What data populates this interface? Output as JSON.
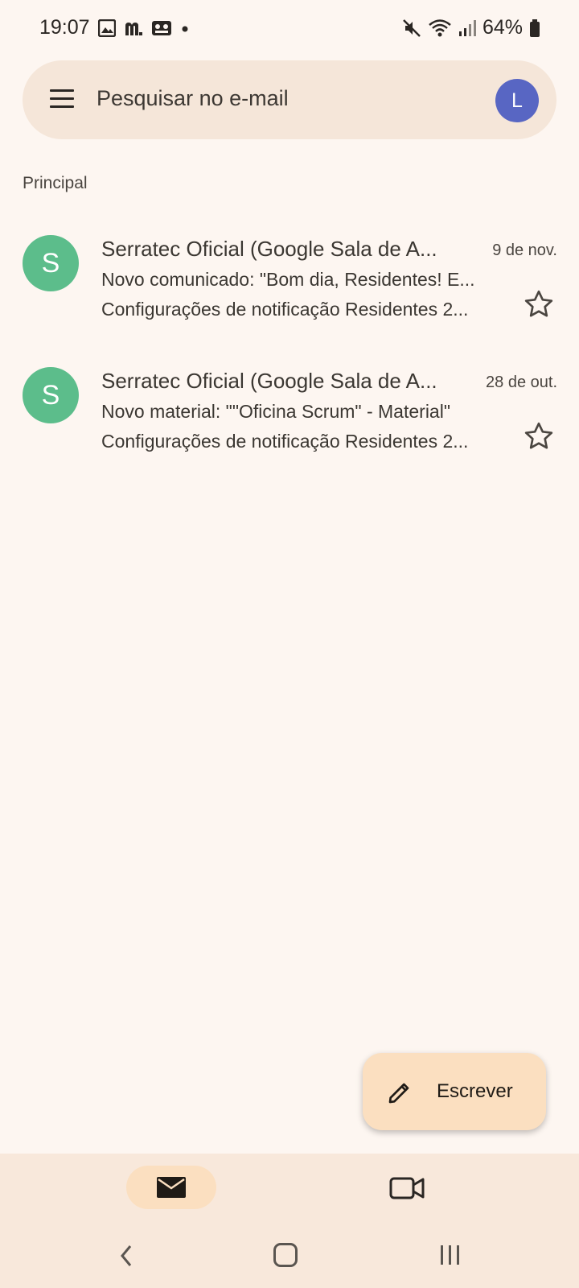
{
  "status_bar": {
    "time": "19:07",
    "battery": "64%",
    "left_icons": [
      "image-icon",
      "m-app-icon",
      "voicemail-icon",
      "dot-icon"
    ],
    "right_icons": [
      "mute-icon",
      "wifi-icon",
      "signal-icon",
      "battery-icon"
    ]
  },
  "search": {
    "placeholder": "Pesquisar no e-mail",
    "avatar_letter": "L",
    "avatar_color": "#5866c3"
  },
  "section": {
    "label": "Principal"
  },
  "emails": [
    {
      "avatar_letter": "S",
      "avatar_color": "#5cbd8b",
      "sender": "Serratec Oficial (Google Sala de A...",
      "date": "9 de nov.",
      "subject": "Novo comunicado: \"Bom dia, Residentes!  E...",
      "snippet": "Configurações de notificação Residentes 2...",
      "starred": false
    },
    {
      "avatar_letter": "S",
      "avatar_color": "#5cbd8b",
      "sender": "Serratec Oficial (Google Sala de A...",
      "date": "28 de out.",
      "subject": "Novo material: \"\"Oficina Scrum\" - Material\"",
      "snippet": "Configurações de notificação Residentes 2...",
      "starred": false
    }
  ],
  "compose": {
    "label": "Escrever"
  },
  "bottom_nav": {
    "items": [
      {
        "icon": "mail-icon",
        "active": true
      },
      {
        "icon": "video-camera-icon",
        "active": false
      }
    ]
  },
  "colors": {
    "background": "#fdf6f1",
    "search_bar": "#f5e6d9",
    "fab": "#fbdfc0",
    "bottom_nav": "#f8e8db"
  }
}
